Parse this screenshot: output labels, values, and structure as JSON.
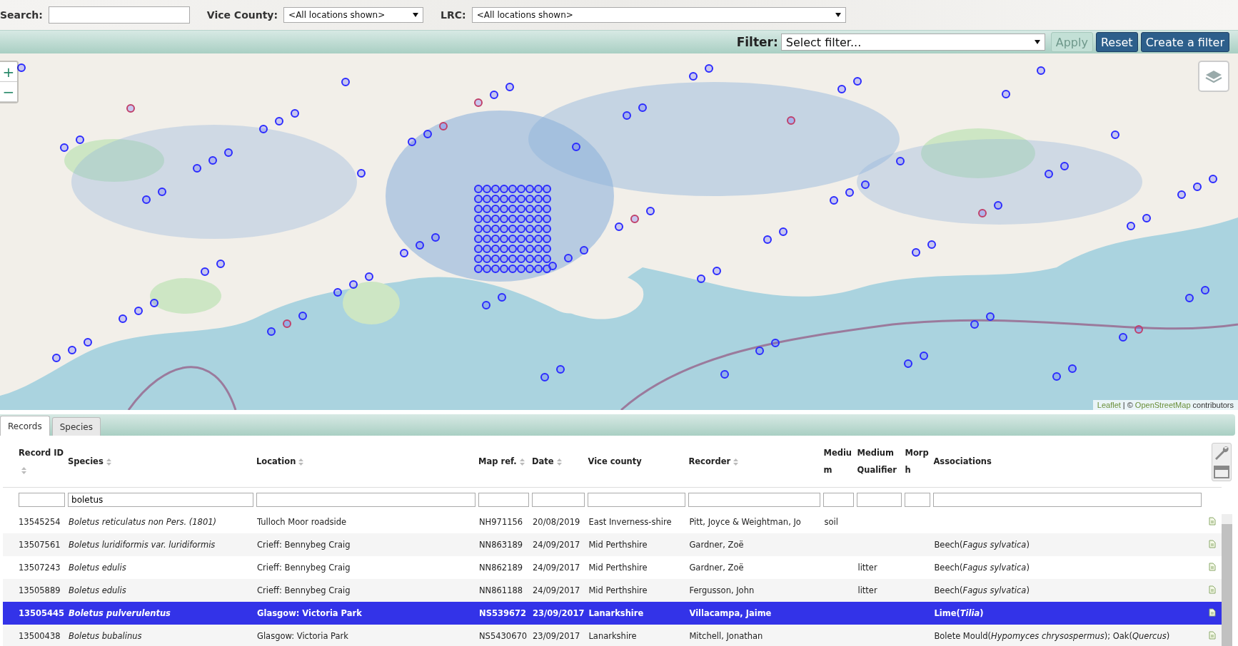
{
  "search": {
    "label": "Search:"
  },
  "vice_county": {
    "label": "Vice County:",
    "value": "<All locations shown>"
  },
  "lrc": {
    "label": "LRC:",
    "value": "<All locations shown>"
  },
  "filter": {
    "label": "Filter:",
    "value": "Select filter...",
    "buttons": [
      {
        "label": "Apply",
        "disabled": true
      },
      {
        "label": "Reset",
        "disabled": false
      },
      {
        "label": "Create a filter",
        "disabled": false
      }
    ]
  },
  "map": {
    "kind": "picture",
    "zoom_controls": [
      "+",
      "−"
    ],
    "attribution": {
      "library": "Leaflet",
      "separator": "| ©",
      "source": "OpenStreetMap",
      "suffix": "contributors"
    }
  },
  "tabs": [
    {
      "label": "Records",
      "selected": true
    },
    {
      "label": "Species",
      "selected": false
    }
  ],
  "table": {
    "columns": [
      {
        "label": "Record ID",
        "sortable": true
      },
      {
        "label": "Species",
        "sortable": true,
        "filter": "boletus"
      },
      {
        "label": "Location",
        "sortable": true
      },
      {
        "label": "Map ref.",
        "sortable": true
      },
      {
        "label": "Date",
        "sortable": true
      },
      {
        "label": "Vice county",
        "sortable": false
      },
      {
        "label": "Recorder",
        "sortable": true
      },
      {
        "label": "Medium",
        "sortable": false
      },
      {
        "label": "Medium Qualifier",
        "sortable": false
      },
      {
        "label": "Morph",
        "sortable": false
      },
      {
        "label": "Associations",
        "sortable": false
      }
    ],
    "rows": [
      {
        "id": "13545254",
        "species": "Boletus reticulatus non Pers. (1801)",
        "location": "Tulloch Moor roadside",
        "map_ref": "NH971156",
        "date": "20/08/2019",
        "vice_county": "East Inverness-shire",
        "recorder": "Pitt, Joyce & Weightman, Jo",
        "medium": "soil",
        "selected": false
      },
      {
        "id": "13507561",
        "species": "Boletus luridiformis var. luridiformis",
        "location": "Crieff: Bennybeg Craig",
        "map_ref": "NN863189",
        "date": "24/09/2017",
        "vice_county": "Mid Perthshire",
        "recorder": "Gardner, Zoë",
        "associations": "Beech(*Fagus sylvatica*)",
        "selected": false
      },
      {
        "id": "13507243",
        "species": "Boletus edulis",
        "location": "Crieff: Bennybeg Craig",
        "map_ref": "NN862189",
        "date": "24/09/2017",
        "vice_county": "Mid Perthshire",
        "recorder": "Gardner, Zoë",
        "medium_qualifier": "litter",
        "associations": "Beech(*Fagus sylvatica*)",
        "selected": false
      },
      {
        "id": "13505889",
        "species": "Boletus edulis",
        "location": "Crieff: Bennybeg Craig",
        "map_ref": "NN861188",
        "date": "24/09/2017",
        "vice_county": "Mid Perthshire",
        "recorder": "Fergusson, John",
        "medium_qualifier": "litter",
        "associations": "Beech(*Fagus sylvatica*)",
        "selected": false
      },
      {
        "id": "13505445",
        "species": "Boletus pulverulentus",
        "location": "Glasgow: Victoria Park",
        "map_ref": "NS539672",
        "date": "23/09/2017",
        "vice_county": "Lanarkshire",
        "recorder": "Villacampa, Jaime",
        "associations": "Lime(*Tilia*)",
        "selected": true
      },
      {
        "id": "13500438",
        "species": "Boletus bubalinus",
        "location": "Glasgow: Victoria Park",
        "map_ref": "NS5430670",
        "date": "23/09/2017",
        "vice_county": "Lanarkshire",
        "recorder": "Mitchell, Jonathan",
        "associations": "Bolete Mould(*Hypomyces chrysospermus*); Oak(*Quercus*)",
        "selected": false
      }
    ]
  }
}
